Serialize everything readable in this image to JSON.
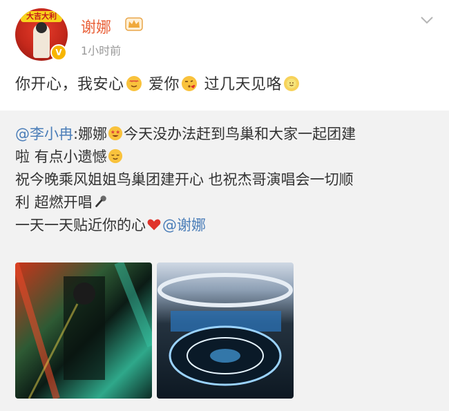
{
  "post": {
    "username": "谢娜",
    "time": "1小时前",
    "text_parts": [
      "你开心，我安心",
      "爱你",
      "过几天见咯"
    ]
  },
  "avatar": {
    "banner": "大吉大利",
    "badge": "V"
  },
  "repost": {
    "author": "@李小冉",
    "line1_a": ":娜娜",
    "line1_b": "今天没办法赶到鸟巢和大家一起团建",
    "line2": "啦 有点小遗憾",
    "line3": "祝今晚乘风姐姐鸟巢团建开心 也祝杰哥演唱会一切顺",
    "line4": "利 超燃开唱",
    "line5": "一天一天贴近你的心",
    "mention2": "@谢娜"
  },
  "icons": [
    "crown-badge-icon",
    "chevron-down-icon",
    "heart-eyes-emoji",
    "kiss-emoji",
    "sun-emoji",
    "star-struck-emoji",
    "relieved-emoji",
    "microphone-emoji",
    "red-heart-emoji"
  ],
  "colors": {
    "username": "#e9623b",
    "mention": "#4a7db8",
    "time": "#999999",
    "repost_bg": "#f2f2f2"
  }
}
